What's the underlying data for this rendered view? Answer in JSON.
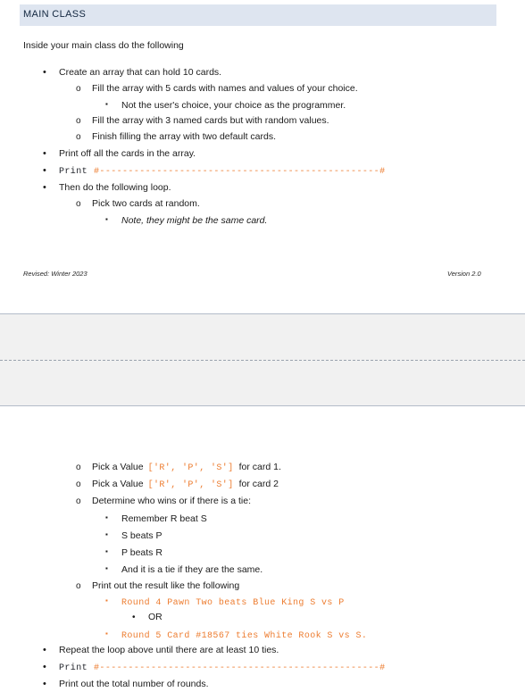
{
  "document": {
    "heading": "MAIN CLASS",
    "intro": "Inside your main class do the following",
    "accent_color": "#ed7d31",
    "heading_bar_color": "#dee5f0"
  },
  "page1": {
    "items": [
      {
        "marker": "•",
        "level": 1,
        "text": "Create an array that can hold 10 cards."
      },
      {
        "marker": "o",
        "level": 2,
        "text": "Fill the array with 5 cards with names and values of your choice."
      },
      {
        "marker": "▪",
        "level": 3,
        "text": "Not the user's choice, your choice as the programmer."
      },
      {
        "marker": "o",
        "level": 2,
        "text": "Fill the array with 3 named cards but with random values."
      },
      {
        "marker": "o",
        "level": 2,
        "text": "Finish filling the array with two default cards."
      },
      {
        "marker": "•",
        "level": 1,
        "text": "Print off all the cards in the array."
      },
      {
        "marker": "•",
        "level": 1,
        "text": "Print",
        "code": "#-------------------------------------------------#"
      },
      {
        "marker": "•",
        "level": 1,
        "text": "Then do the following loop."
      },
      {
        "marker": "o",
        "level": 2,
        "text": "Pick two cards at random."
      },
      {
        "marker": "▪",
        "level": 3,
        "text": "Note, they might be the same card.",
        "italic": true
      }
    ],
    "footer_left": "Revised: Winter 2023",
    "footer_right": "Version 2.0"
  },
  "page2": {
    "items": [
      {
        "marker": "o",
        "level": 2,
        "pre": "Pick a Value",
        "code": "['R', 'P', 'S']",
        "post": "for card 1."
      },
      {
        "marker": "o",
        "level": 2,
        "pre": "Pick a Value",
        "code": "['R', 'P', 'S']",
        "post": "for card 2"
      },
      {
        "marker": "o",
        "level": 2,
        "text": "Determine who wins or if there is a tie:"
      },
      {
        "marker": "▪",
        "level": 3,
        "text": "Remember R beat S"
      },
      {
        "marker": "▪",
        "level": 3,
        "text": "S beats P"
      },
      {
        "marker": "▪",
        "level": 3,
        "text": "P beats R"
      },
      {
        "marker": "▪",
        "level": 3,
        "text": "And it is a tie if they are the same."
      },
      {
        "marker": "o",
        "level": 2,
        "text": "Print out the result like the following"
      },
      {
        "marker": "▪",
        "level": 3,
        "code_accent": "Round 4 Pawn Two beats Blue King S vs P"
      },
      {
        "marker": "•",
        "level": 4,
        "text": "OR"
      },
      {
        "marker": "▪",
        "level": 3,
        "code_accent": "Round 5 Card #18567 ties White Rook S vs S."
      },
      {
        "marker": "•",
        "level": 1,
        "text": "Repeat the loop above until there are at least 10 ties."
      },
      {
        "marker": "•",
        "level": 1,
        "text": "Print",
        "code": "#-------------------------------------------------#"
      },
      {
        "marker": "•",
        "level": 1,
        "text": "Print out the total number of rounds."
      }
    ]
  }
}
